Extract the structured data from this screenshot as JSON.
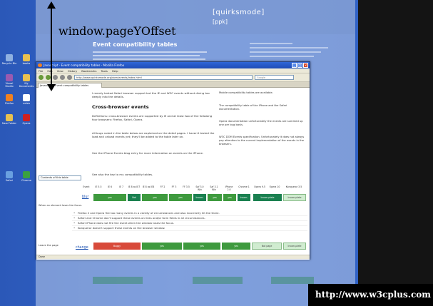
{
  "annotation": {
    "label": "window.pageYOffset"
  },
  "watermark": {
    "text": "http://www.w3cplus.com"
  },
  "background_page": {
    "logo": "[quirksmode]",
    "logo_sub": "[ppk]",
    "heading": "Event compatibility tables"
  },
  "desktop_icons": [
    {
      "label": "Recycle Bin"
    },
    {
      "label": "books"
    },
    {
      "label": "Visual Studio"
    },
    {
      "label": "My Documents"
    },
    {
      "label": "Firefox"
    },
    {
      "label": "notes"
    },
    {
      "label": "New Folder"
    },
    {
      "label": "Opera"
    },
    {
      "label": "Safari"
    },
    {
      "label": "Chrome"
    }
  ],
  "window": {
    "title": "Javascript - Event compatibility tables - Mozilla Firefox",
    "menu": [
      "File",
      "Edit",
      "View",
      "History",
      "Bookmarks",
      "Tools",
      "Help"
    ],
    "url": "http://www.quirksmode.org/dom/events/index.html",
    "search_placeholder": "Google",
    "tab_label": "Javascript - Event compatibility tables",
    "status": "Done"
  },
  "content": {
    "intro": "I merely tested Safari browser support but the IE and W3C events without diving too deeply into the details.",
    "heading_crossbrowser": "Cross-browser events",
    "crossbrowser_text": "Definitions: cross-browser events are supported by IE and at least two of the following four browsers: Firefox, Safari, Opera.",
    "bugs_text": "All bugs noted in the table below are explained on the detail pages. I haven't tested the load and unload events yet; they'll be added to the table later on.",
    "see_text": "See the iPhone Events blog entry for more information on events on the iPhone.",
    "see_also": "See also the key to my compatibility tables.",
    "sidebar": [
      "Mobile compatibility tables are available.",
      "The compatibility table of the iPhone and the Safari documentation.",
      "Opera documentation unfortunately the events are summed up one per bug basis.",
      "W3C DOM Events specification. Unfortunately it does not always pay attention to the current implementation of the events in the browsers."
    ]
  },
  "table": {
    "selector": "Contents of this table",
    "headers": [
      "Event",
      "IE 5.5",
      "IE 6",
      "IE 7",
      "IE 8 as IE7",
      "IE 8 as IE8",
      "FF 2",
      "FF 3",
      "FF 3.5",
      "Saf 3.0 Win",
      "Saf 3.1 Win",
      "iPhone 2.0",
      "Chrome 1",
      "Opera 9.5",
      "Opera 10",
      "Konqueror 3.5"
    ],
    "row1": {
      "label": "When an element loses the focus.",
      "link": "blur",
      "cells": [
        "yes",
        "Not created",
        "yes",
        "yes",
        "Incom-plete",
        "yes",
        "yes",
        "Incom-plete",
        "Incom-plete",
        "Not created",
        "Not created",
        "Incom-plete"
      ]
    },
    "row2": {
      "label": "Leave the page",
      "link": "change",
      "cells": [
        "Buggy",
        "yes",
        "yes",
        "yes",
        "Incom-plete",
        "Not page",
        "Incom-plete"
      ]
    },
    "bullets": [
      "Firefox 2 and Opera fire too many events in a variety of circumstances and also incorrectly hit the three.",
      "Safari and Chrome don't support these events on links and/or form fields in all circumstances.",
      "Safari iPhone does not fire the event when the window loses the focus.",
      "Konqueror doesn't support these events on the browser window."
    ]
  }
}
